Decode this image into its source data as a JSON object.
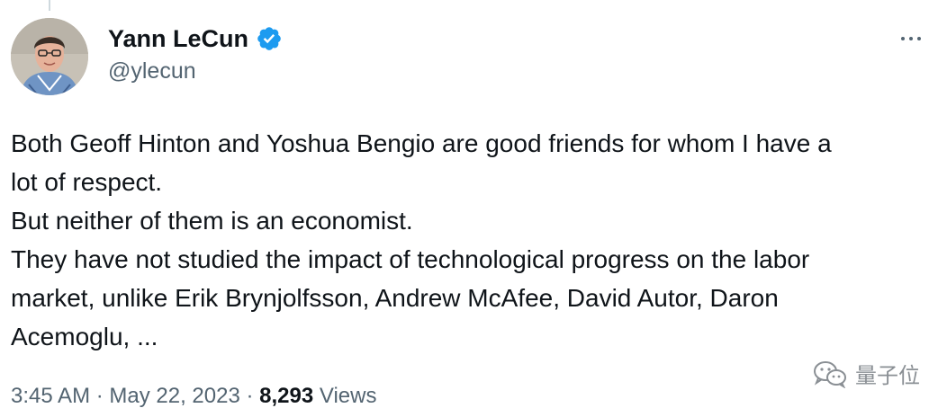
{
  "author": {
    "display_name": "Yann LeCun",
    "handle": "@ylecun",
    "verified": true
  },
  "tweet": {
    "lines": [
      "Both Geoff Hinton and Yoshua Bengio are good friends for whom I have a",
      "lot of respect.",
      "But neither of them is an economist.",
      "They have not studied the impact of technological progress on the labor",
      "market, unlike Erik Brynjolfsson, Andrew McAfee, David Autor, Daron",
      "Acemoglu, ..."
    ]
  },
  "meta": {
    "time": "3:45 AM",
    "separator": " · ",
    "date": "May 22, 2023",
    "views_count": "8,293",
    "views_label": " Views"
  },
  "watermark": {
    "text": "量子位"
  },
  "icons": {
    "verified": "verified-badge-icon",
    "more": "more-options-icon",
    "watermark": "wechat-icon"
  },
  "colors": {
    "text": "#0f1419",
    "secondary": "#536471",
    "verified_blue": "#1d9bf0"
  }
}
